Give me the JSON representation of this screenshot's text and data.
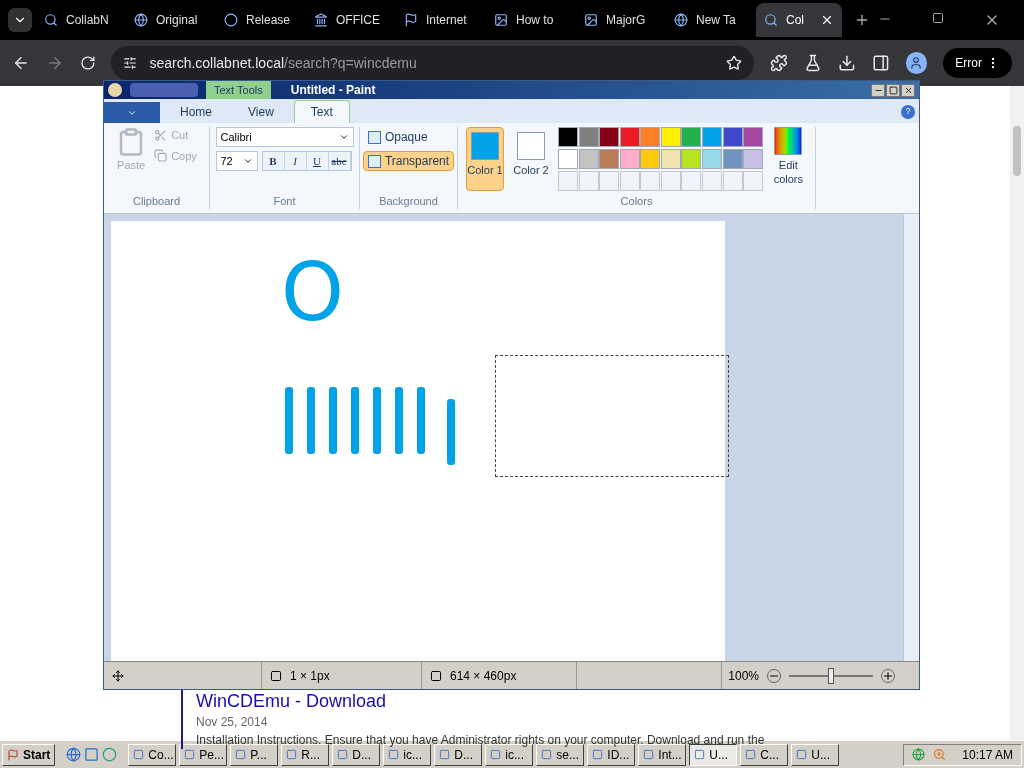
{
  "browser": {
    "tabs": [
      {
        "title": "CollabN",
        "selected": false
      },
      {
        "title": "Original",
        "selected": false
      },
      {
        "title": "Release",
        "selected": false
      },
      {
        "title": "OFFICE",
        "selected": false
      },
      {
        "title": "Internet",
        "selected": false
      },
      {
        "title": "How to",
        "selected": false
      },
      {
        "title": "MajorG",
        "selected": false
      },
      {
        "title": "New Ta",
        "selected": false
      },
      {
        "title": "Col",
        "selected": true
      }
    ],
    "url_host": "search.collabnet.local",
    "url_path": "/search?q=wincdemu",
    "profile_label": "Error"
  },
  "page": {
    "result_title": "WinCDEmu - Download",
    "date": "Nov 25, 2014",
    "snippet": "Installation Instructions. Ensure that you have Administrator rights on your computer. Download and run the"
  },
  "paint": {
    "title": "Untitled - Paint",
    "context_tab": "Text Tools",
    "help_label": "?",
    "ribbon_tabs": [
      {
        "label": "Home",
        "selected": false
      },
      {
        "label": "View",
        "selected": false
      },
      {
        "label": "Text",
        "selected": true
      }
    ],
    "clipboard": {
      "paste": "Paste",
      "cut": "Cut",
      "copy": "Copy",
      "disabled": true,
      "label": "Clipboard"
    },
    "font": {
      "family": "Calibri",
      "size": "72",
      "format_buttons": [
        "B",
        "I",
        "U",
        "abc"
      ],
      "label": "Font"
    },
    "background": {
      "options": [
        {
          "label": "Opaque",
          "selected": false
        },
        {
          "label": "Transparent",
          "selected": true
        }
      ],
      "label": "Background"
    },
    "colors": {
      "slots": [
        {
          "label": "Color 1",
          "color": "#00a2e8",
          "selected": true
        },
        {
          "label": "Color 2",
          "color": "#ffffff",
          "selected": false
        }
      ],
      "palette": [
        {
          "color": "#000000"
        },
        {
          "color": "#7f7f7f"
        },
        {
          "color": "#880015"
        },
        {
          "color": "#ed1c24"
        },
        {
          "color": "#ff7f27"
        },
        {
          "color": "#fff200"
        },
        {
          "color": "#22b14c"
        },
        {
          "color": "#00a2e8"
        },
        {
          "color": "#3f48cc"
        },
        {
          "color": "#a349a4"
        },
        {
          "color": "#ffffff"
        },
        {
          "color": "#c3c3c3"
        },
        {
          "color": "#b97a57"
        },
        {
          "color": "#ffaec9"
        },
        {
          "color": "#ffc90e"
        },
        {
          "color": "#efe4b0"
        },
        {
          "color": "#b5e61d"
        },
        {
          "color": "#99d9ea"
        },
        {
          "color": "#7092be"
        },
        {
          "color": "#c8bfe7"
        }
      ],
      "edit": "Edit colors",
      "label": "Colors"
    },
    "canvas": {
      "letter": "O"
    },
    "status": {
      "selection_size": "1 × 1px",
      "image_size": "614 × 460px",
      "zoom": "100%",
      "level": 0.5
    }
  },
  "taskbar": {
    "start": "Start",
    "items": [
      {
        "label": "Co...",
        "selected": false
      },
      {
        "label": "Pe...",
        "selected": false
      },
      {
        "label": "P...",
        "selected": false
      },
      {
        "label": "R...",
        "selected": false
      },
      {
        "label": "D...",
        "selected": false
      },
      {
        "label": "ic...",
        "selected": false
      },
      {
        "label": "D...",
        "selected": false
      },
      {
        "label": "ic...",
        "selected": false
      },
      {
        "label": "se...",
        "selected": false
      },
      {
        "label": "ID...",
        "selected": false
      },
      {
        "label": "Int...",
        "selected": false
      },
      {
        "label": "U...",
        "selected": true
      },
      {
        "label": "C...",
        "selected": false
      },
      {
        "label": "U...",
        "selected": false
      }
    ],
    "clock": "10:17 AM"
  }
}
